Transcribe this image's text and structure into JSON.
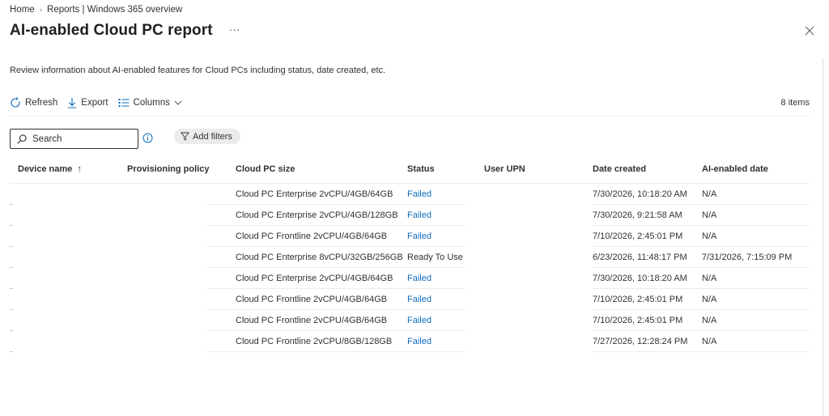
{
  "breadcrumb": {
    "items": [
      "Home",
      "Reports | Windows 365 overview"
    ],
    "separator": "›"
  },
  "page": {
    "title": "AI-enabled Cloud PC report",
    "more_label": "···",
    "description": "Review information about AI-enabled features for Cloud PCs including status, date created, etc."
  },
  "toolbar": {
    "refresh_label": "Refresh",
    "export_label": "Export",
    "columns_label": "Columns",
    "items_count": "8 items"
  },
  "filter": {
    "search_placeholder": "Search",
    "add_filters_label": "Add filters"
  },
  "table": {
    "columns": [
      "Device name",
      "Provisioning policy",
      "Cloud PC size",
      "Status",
      "User UPN",
      "Date created",
      "AI-enabled date"
    ],
    "sort_indicator": "↑",
    "rows": [
      {
        "device": "",
        "policy": "",
        "size": "Cloud PC Enterprise 2vCPU/4GB/64GB",
        "status": "Failed",
        "upn": "",
        "created": "7/30/2026, 10:18:20 AM",
        "ai_date": "N/A"
      },
      {
        "device": "",
        "policy": "",
        "size": "Cloud PC Enterprise 2vCPU/4GB/128GB",
        "status": "Failed",
        "upn": "",
        "created": "7/30/2026, 9:21:58 AM",
        "ai_date": "N/A"
      },
      {
        "device": "",
        "policy": "",
        "size": "Cloud PC Frontline 2vCPU/4GB/64GB",
        "status": "Failed",
        "upn": "",
        "created": "7/10/2026, 2:45:01 PM",
        "ai_date": "N/A"
      },
      {
        "device": "",
        "policy": "",
        "size": "Cloud PC Enterprise 8vCPU/32GB/256GB",
        "status": "Ready To Use",
        "upn": "",
        "created": "6/23/2026, 11:48:17 PM",
        "ai_date": "7/31/2026, 7:15:09 PM"
      },
      {
        "device": "",
        "policy": "",
        "size": "Cloud PC Enterprise 2vCPU/4GB/64GB",
        "status": "Failed",
        "upn": "",
        "created": "7/30/2026, 10:18:20 AM",
        "ai_date": "N/A"
      },
      {
        "device": "",
        "policy": "",
        "size": "Cloud PC Frontline 2vCPU/4GB/64GB",
        "status": "Failed",
        "upn": "",
        "created": "7/10/2026, 2:45:01 PM",
        "ai_date": "N/A"
      },
      {
        "device": "",
        "policy": "",
        "size": "Cloud PC Frontline 2vCPU/4GB/64GB",
        "status": "Failed",
        "upn": "",
        "created": "7/10/2026, 2:45:01 PM",
        "ai_date": "N/A"
      },
      {
        "device": "",
        "policy": "",
        "size": "Cloud PC Frontline 2vCPU/8GB/128GB",
        "status": "Failed",
        "upn": "",
        "created": "7/27/2026, 12:28:24 PM",
        "ai_date": "N/A"
      }
    ]
  },
  "colors": {
    "link_blue": "#0f6cbd",
    "text": "#323130",
    "divider": "#edebe9",
    "filter_pill": "#ebebeb"
  },
  "icons": [
    "refresh-icon",
    "export-icon",
    "columns-icon",
    "chevron-down-icon",
    "search-icon",
    "info-icon",
    "filter-icon",
    "close-icon",
    "sort-ascending-icon"
  ]
}
